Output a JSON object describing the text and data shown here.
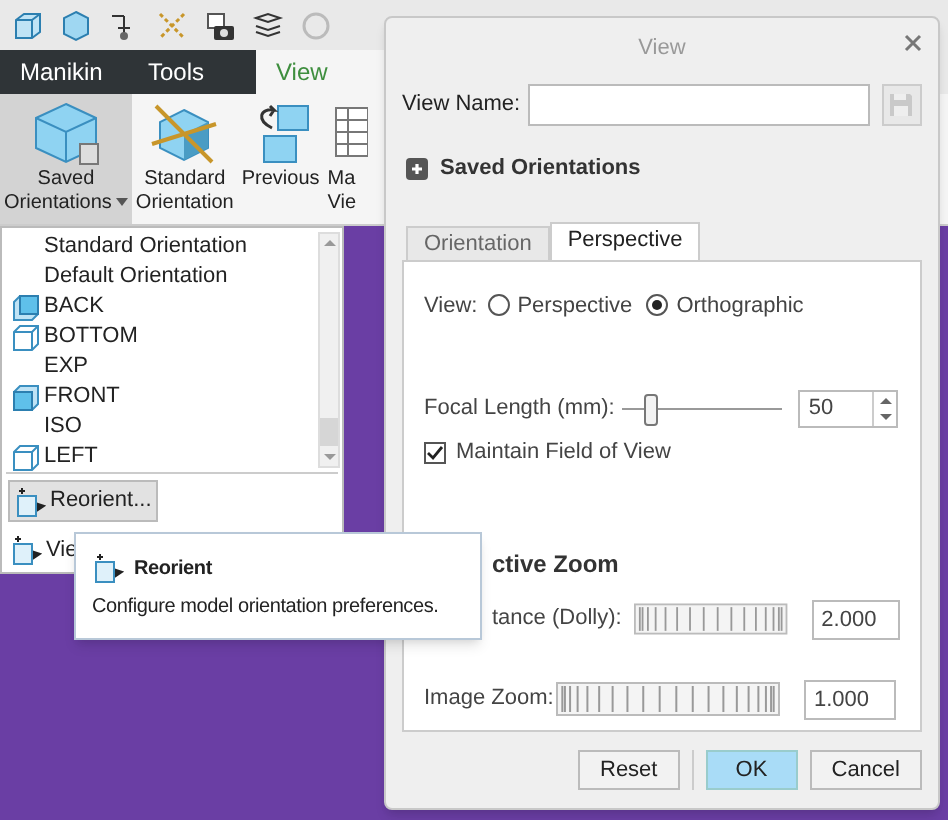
{
  "ribbon": {
    "tabs": [
      {
        "label": "Manikin",
        "selected": false
      },
      {
        "label": "Tools",
        "selected": false
      },
      {
        "label": "View",
        "selected": true
      }
    ],
    "buttons": [
      {
        "kind": "saved",
        "lines": [
          "Saved",
          "Orientations"
        ],
        "selected": true,
        "dropdown": true
      },
      {
        "kind": "standard",
        "lines": [
          "Standard",
          "Orientation"
        ],
        "selected": false,
        "dropdown": false
      },
      {
        "kind": "previous",
        "lines": [
          "Previous"
        ],
        "selected": false,
        "dropdown": false
      },
      {
        "kind": "manager",
        "lines": [
          "Ma",
          "Vie"
        ],
        "selected": false,
        "dropdown": false
      }
    ]
  },
  "orientation_menu": {
    "items": [
      {
        "label": "Standard Orientation",
        "kind": "plain"
      },
      {
        "label": "Default Orientation",
        "kind": "plain"
      },
      {
        "label": "BACK",
        "kind": "back"
      },
      {
        "label": "BOTTOM",
        "kind": "wire"
      },
      {
        "label": "EXP",
        "kind": "plain"
      },
      {
        "label": "FRONT",
        "kind": "front"
      },
      {
        "label": "ISO",
        "kind": "plain"
      },
      {
        "label": "LEFT",
        "kind": "wire"
      }
    ],
    "reorient_button": "Reorient...",
    "view_item": "Vie"
  },
  "tooltip": {
    "title": "Reorient",
    "description": "Configure model orientation preferences."
  },
  "dialog": {
    "title": "View",
    "view_name": {
      "label": "View Name:"
    },
    "saved_orientations": {
      "label": "Saved Orientations",
      "expanded": false
    },
    "tabs": [
      {
        "label": "Orientation",
        "selected": false
      },
      {
        "label": "Perspective",
        "selected": true
      }
    ],
    "view_mode": {
      "label": "View:",
      "options": [
        {
          "label": "Perspective",
          "selected": false
        },
        {
          "label": "Orthographic",
          "selected": true
        }
      ]
    },
    "focal_length": {
      "label": "Focal Length (mm):",
      "level": 0.17,
      "value": "50"
    },
    "maintain_fov": {
      "label": "Maintain Field of View",
      "checked": true
    },
    "zoom_section": "ctive Zoom",
    "zoom_rows": [
      {
        "label": "tance (Dolly):",
        "value": "2.000"
      },
      {
        "label": "Image Zoom:",
        "value": "1.000"
      }
    ],
    "buttons": [
      {
        "label": "Reset",
        "default": false
      },
      {
        "label": "OK",
        "default": true
      },
      {
        "label": "Cancel",
        "default": false
      }
    ]
  }
}
